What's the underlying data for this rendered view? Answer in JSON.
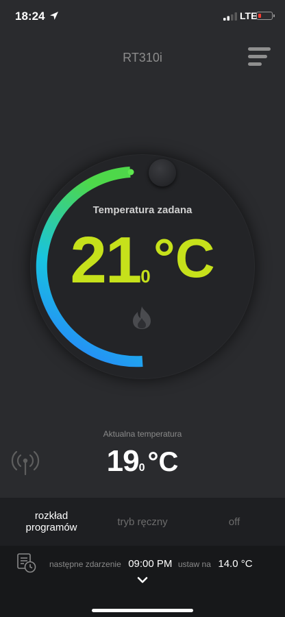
{
  "status_bar": {
    "time": "18:24",
    "network": "LTE"
  },
  "header": {
    "title": "RT310i"
  },
  "thermostat": {
    "set_label": "Temperatura zadana",
    "set_int": "21",
    "set_dec": "0",
    "set_unit": "°C",
    "accent_color": "#c6e11b"
  },
  "actual": {
    "label": "Aktualna temperatura",
    "int": "19",
    "dec": "0",
    "unit": "°C"
  },
  "modes": [
    {
      "line1": "rozkład",
      "line2": "programów",
      "active": true
    },
    {
      "line1": "tryb ręczny",
      "line2": "",
      "active": false
    },
    {
      "line1": "off",
      "line2": "",
      "active": false
    }
  ],
  "next_event": {
    "label": "następne zdarzenie",
    "time": "09:00 PM",
    "set_label": "ustaw na",
    "temp": "14.0 °C"
  }
}
